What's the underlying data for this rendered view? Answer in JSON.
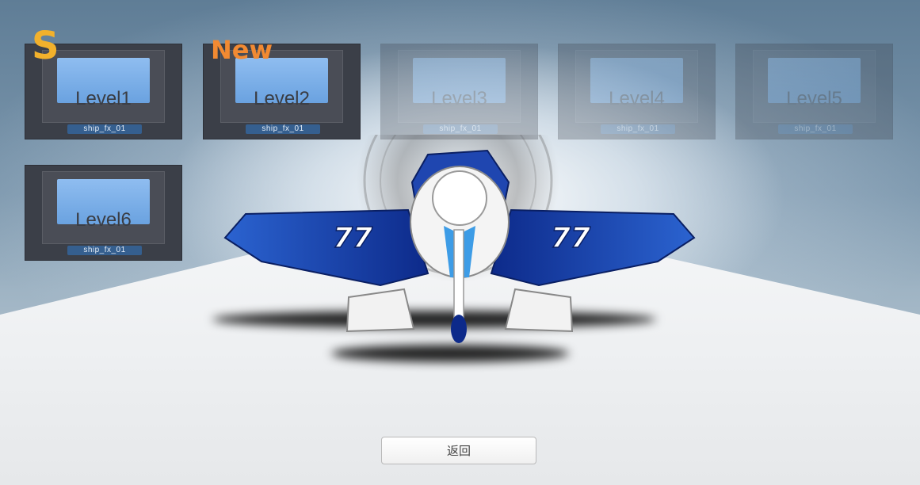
{
  "levels": [
    {
      "label": "Level1",
      "tag": "ship_fx_01",
      "locked": false,
      "badge": "S"
    },
    {
      "label": "Level2",
      "tag": "ship_fx_01",
      "locked": false,
      "badge": "New"
    },
    {
      "label": "Level3",
      "tag": "ship_fx_01",
      "locked": true
    },
    {
      "label": "Level4",
      "tag": "ship_fx_01",
      "locked": true
    },
    {
      "label": "Level5",
      "tag": "ship_fx_01",
      "locked": true
    },
    {
      "label": "Level6",
      "tag": "ship_fx_01",
      "locked": false
    }
  ],
  "plane": {
    "number": "77",
    "color_primary": "#1f4fb8",
    "color_secondary": "#ffffff"
  },
  "back_button": {
    "label": "返回"
  },
  "colors": {
    "badge_s": "#f2b12c",
    "badge_new": "#f28a32",
    "screen": "#7bb0e8",
    "tag_bg": "#355f8f"
  }
}
